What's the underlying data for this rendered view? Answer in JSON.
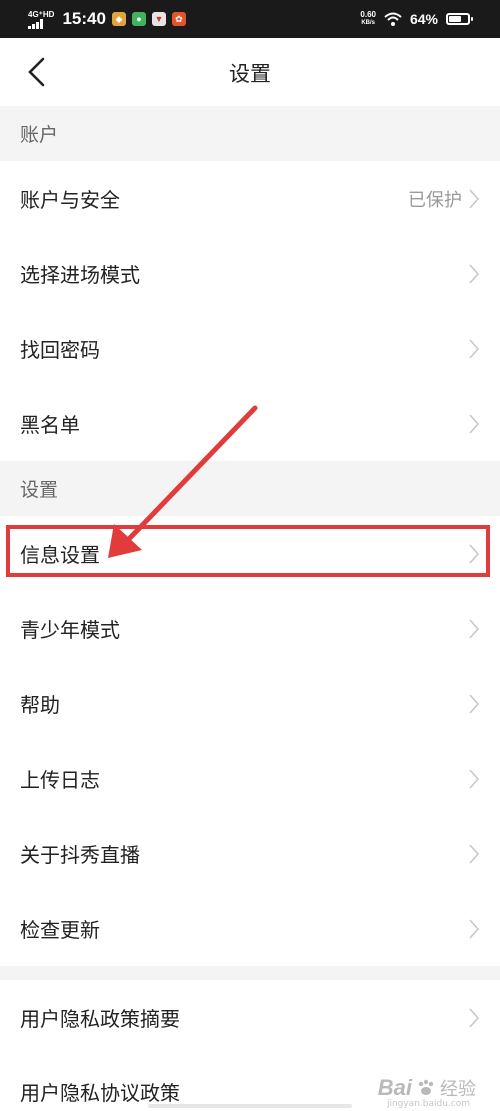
{
  "status_bar": {
    "network": "4G⁺HD",
    "time": "15:40",
    "net_speed_value": "0.60",
    "net_speed_unit": "KB/s",
    "battery_percent": "64%",
    "battery_level": 0.64
  },
  "header": {
    "title": "设置",
    "back_icon": "chevron-left-icon"
  },
  "sections": [
    {
      "header": "账户",
      "items": [
        {
          "label": "账户与安全",
          "value": "已保护"
        },
        {
          "label": "选择进场模式",
          "value": ""
        },
        {
          "label": "找回密码",
          "value": ""
        },
        {
          "label": "黑名单",
          "value": ""
        }
      ]
    },
    {
      "header": "设置",
      "items": [
        {
          "label": "信息设置",
          "value": "",
          "highlighted": true
        },
        {
          "label": "青少年模式",
          "value": ""
        },
        {
          "label": "帮助",
          "value": ""
        },
        {
          "label": "上传日志",
          "value": ""
        },
        {
          "label": "关于抖秀直播",
          "value": ""
        },
        {
          "label": "检查更新",
          "value": ""
        }
      ]
    },
    {
      "header": "",
      "items": [
        {
          "label": "用户隐私政策摘要",
          "value": ""
        },
        {
          "label": "用户隐私协议政策",
          "value": ""
        }
      ]
    }
  ],
  "annotation": {
    "highlight_color": "#e13b3b",
    "arrow_color": "#e13b3b"
  },
  "watermark": {
    "brand": "Bai",
    "suffix": "经验",
    "url": "jingyan.baidu.com"
  }
}
